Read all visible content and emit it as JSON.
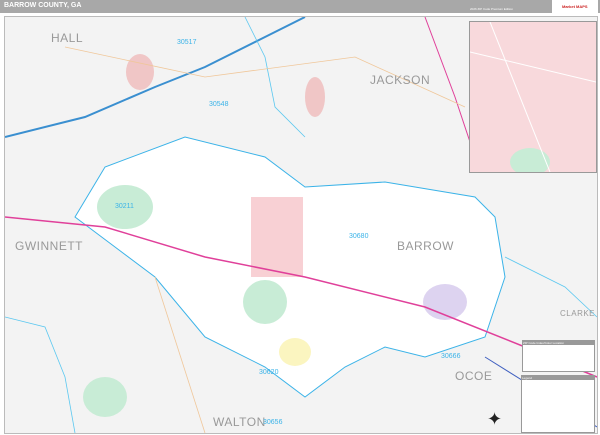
{
  "header": {
    "title": "BARROW COUNTY, GA",
    "edition": "2026 ZIP Code Premium Edition",
    "logo": "Market MAPS"
  },
  "counties": [
    "HALL",
    "JACKSON",
    "GWINNETT",
    "BARROW",
    "CLARKE",
    "OCOE",
    "WALTON"
  ],
  "zips": [
    "30517",
    "30548",
    "30211",
    "30680",
    "30620",
    "30666",
    "30656"
  ],
  "legend": {
    "index_title": "ZIP Code Index/Color Location",
    "legend_title": "Legend"
  },
  "colors": {
    "county": "#ffffff",
    "outside": "#f3f3f3",
    "water": "#5cc8f0",
    "highway": "#e0409a",
    "boundary": "#3bb3e8"
  }
}
